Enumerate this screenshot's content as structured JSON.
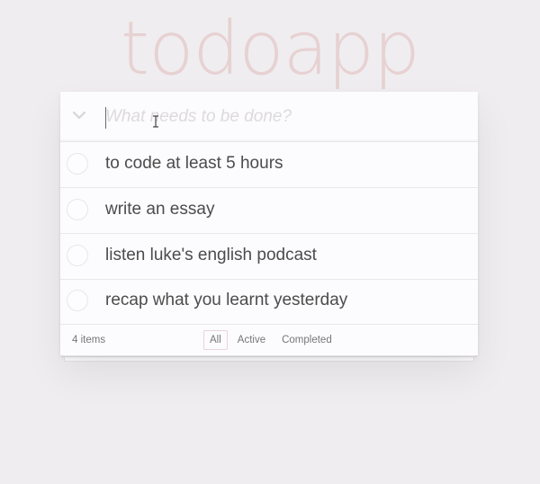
{
  "app": {
    "title": "todoapp"
  },
  "new_todo": {
    "placeholder": "What needs to be done?",
    "value": ""
  },
  "todos": [
    {
      "label": "to code at least 5 hours",
      "completed": false
    },
    {
      "label": "write an essay",
      "completed": false
    },
    {
      "label": "listen luke's english podcast",
      "completed": false
    },
    {
      "label": "recap what you learnt yesterday",
      "completed": false
    }
  ],
  "footer": {
    "count_text": "4 items",
    "filters": [
      {
        "label": "All",
        "selected": true
      },
      {
        "label": "Active",
        "selected": false
      },
      {
        "label": "Completed",
        "selected": false
      }
    ]
  },
  "colors": {
    "background": "#efedef",
    "title": "#e9d4d4",
    "card": "#fcfbfd"
  },
  "icons": {
    "toggle_all": "chevron-down-icon",
    "cursor": "text-cursor-icon"
  }
}
